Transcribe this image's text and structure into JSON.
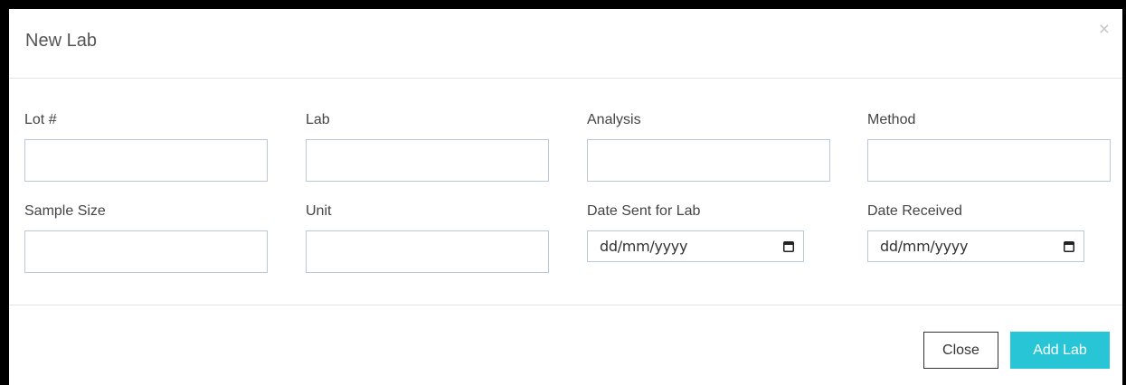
{
  "modal": {
    "title": "New Lab",
    "close_symbol": "×"
  },
  "fields": {
    "lot": {
      "label": "Lot #",
      "value": ""
    },
    "lab": {
      "label": "Lab",
      "value": ""
    },
    "analysis": {
      "label": "Analysis",
      "value": ""
    },
    "method": {
      "label": "Method",
      "value": ""
    },
    "sample_size": {
      "label": "Sample Size",
      "value": ""
    },
    "unit": {
      "label": "Unit",
      "value": ""
    },
    "date_sent": {
      "label": "Date Sent for Lab",
      "value": "dd/mm/yyyy",
      "icon": "calendar-icon"
    },
    "date_received": {
      "label": "Date Received",
      "value": "dd/mm/yyyy",
      "icon": "calendar-icon"
    }
  },
  "footer": {
    "close_label": "Close",
    "add_label": "Add Lab"
  },
  "colors": {
    "accent": "#27c5d6",
    "input_border": "#b9c7d6",
    "backdrop": "#000000"
  }
}
